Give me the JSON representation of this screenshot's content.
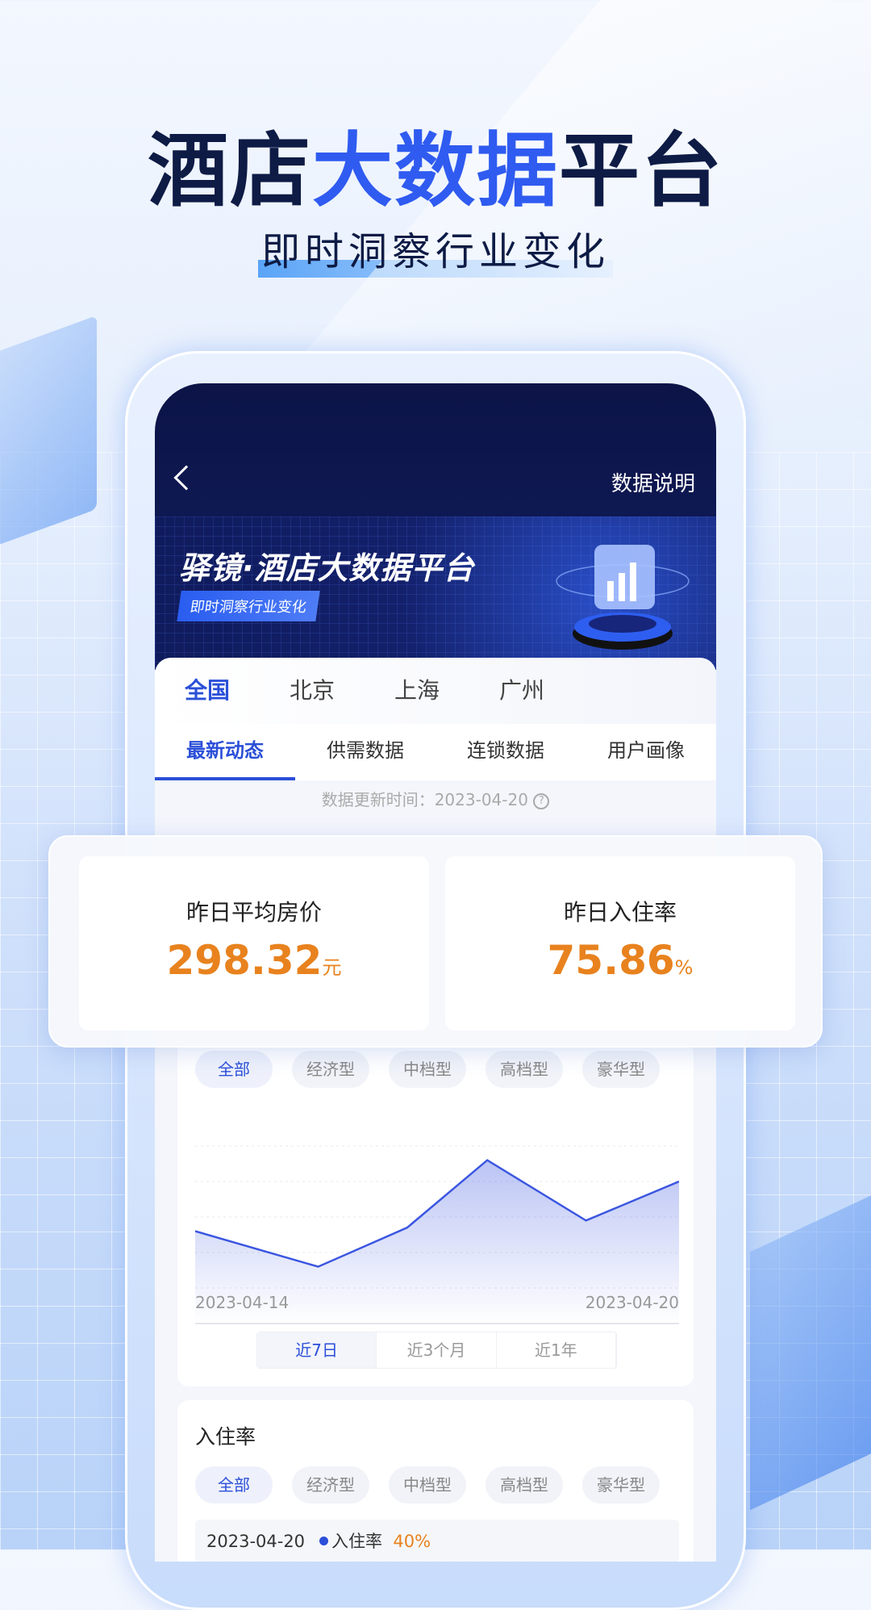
{
  "hero": {
    "title_part1": "酒店",
    "title_highlight": "大数据",
    "title_part2": "平台",
    "subtitle": "即时洞察行业变化"
  },
  "header": {
    "explain": "数据说明",
    "banner_title": "驿镜·酒店大数据平台",
    "banner_tag": "即时洞察行业变化"
  },
  "cities": [
    "全国",
    "北京",
    "上海",
    "广州"
  ],
  "subtabs": [
    "最新动态",
    "供需数据",
    "连锁数据",
    "用户画像"
  ],
  "update": {
    "label": "数据更新时间：2023-04-20",
    "help": "?"
  },
  "kpis": [
    {
      "label": "昨日平均房价",
      "value": "298.32",
      "unit": "元"
    },
    {
      "label": "昨日入住率",
      "value": "75.86",
      "unit": "%"
    }
  ],
  "chips": [
    "全部",
    "经济型",
    "中档型",
    "高档型",
    "豪华型"
  ],
  "chart_data": {
    "type": "area",
    "x_labels": [
      "2023-04-14",
      "2023-04-20"
    ],
    "values": [
      2.6,
      1.6,
      2.7,
      4.6,
      2.9,
      4.0
    ],
    "ylim": [
      0,
      5
    ],
    "grid": true,
    "color": "#3b56e0"
  },
  "ranges": [
    "近7日",
    "近3个月",
    "近1年"
  ],
  "occupancy": {
    "title": "入住率",
    "date": "2023-04-20",
    "series": "入住率",
    "value": "40%",
    "unit": "%"
  },
  "colors": {
    "accent": "#2b4fd8",
    "value": "#e8821e",
    "navy": "#0d1b45"
  }
}
